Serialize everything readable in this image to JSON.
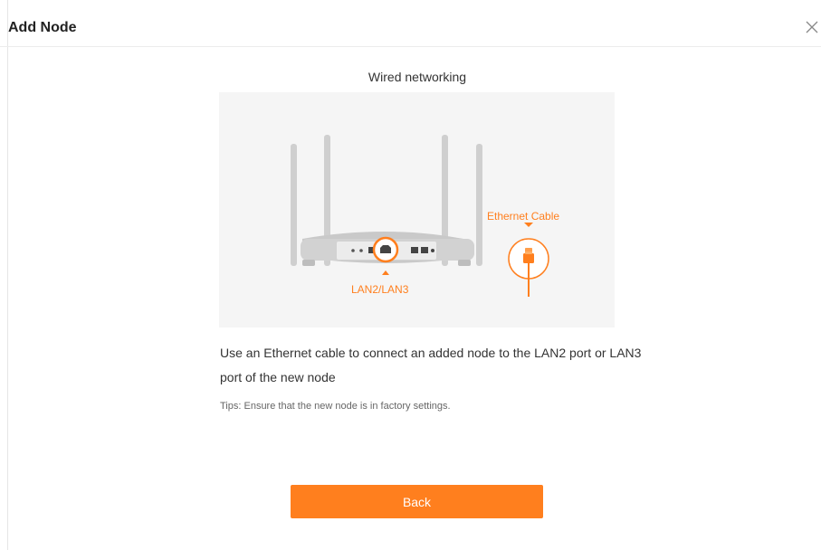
{
  "dialog": {
    "title": "Add Node",
    "close_icon": "close-icon"
  },
  "content": {
    "subtitle": "Wired networking",
    "illustration": {
      "port_label": "LAN2/LAN3",
      "cable_label": "Ethernet Cable",
      "accent_color": "#ff7f1e"
    },
    "description": "Use an Ethernet cable to connect an added node to the LAN2 port or LAN3 port of the new node",
    "tips": "Tips: Ensure that the new node is in factory settings."
  },
  "actions": {
    "back_label": "Back"
  }
}
